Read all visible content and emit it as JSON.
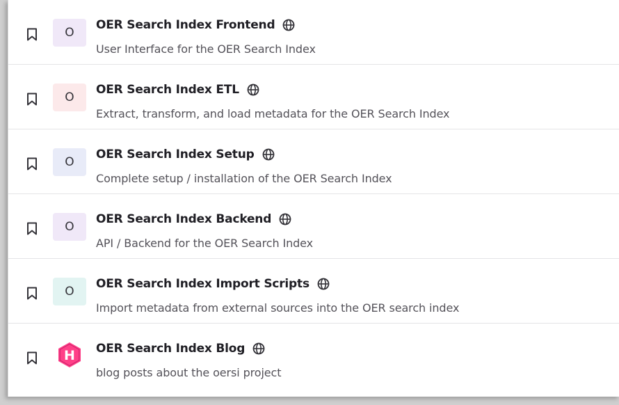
{
  "colors": {
    "avatar_purple": "#f0e8f8",
    "avatar_red": "#fce9ea",
    "avatar_blue": "#e8ebf8",
    "avatar_teal": "#e2f4f2",
    "hugo_pink": "#ff4088"
  },
  "projects": [
    {
      "avatar_letter": "O",
      "avatar_color": "#f0e8f8",
      "title": "OER Search Index Frontend",
      "description": "User Interface for the OER Search Index",
      "visibility_icon": "globe-icon"
    },
    {
      "avatar_letter": "O",
      "avatar_color": "#fce9ea",
      "title": "OER Search Index ETL",
      "description": "Extract, transform, and load metadata for the OER Search Index",
      "visibility_icon": "globe-icon"
    },
    {
      "avatar_letter": "O",
      "avatar_color": "#e8ebf8",
      "title": "OER Search Index Setup",
      "description": "Complete setup / installation of the OER Search Index",
      "visibility_icon": "globe-icon"
    },
    {
      "avatar_letter": "O",
      "avatar_color": "#f0e8f8",
      "title": "OER Search Index Backend",
      "description": "API / Backend for the OER Search Index",
      "visibility_icon": "globe-icon"
    },
    {
      "avatar_letter": "O",
      "avatar_color": "#e2f4f2",
      "title": "OER Search Index Import Scripts",
      "description": "Import metadata from external sources into the OER search index",
      "visibility_icon": "globe-icon"
    },
    {
      "avatar_letter": "H",
      "avatar_icon": "hugo-logo-icon",
      "title": "OER Search Index Blog",
      "description": "blog posts about the oersi project",
      "visibility_icon": "globe-icon"
    }
  ]
}
